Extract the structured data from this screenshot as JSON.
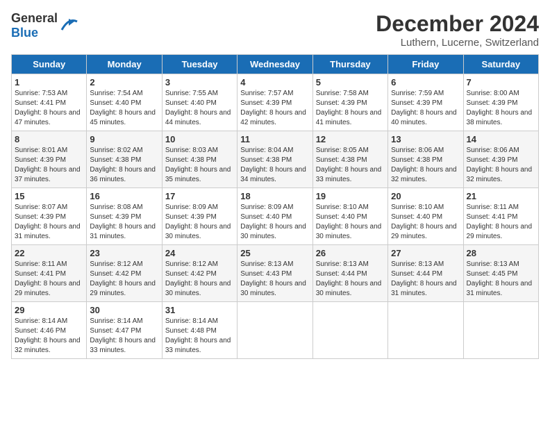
{
  "header": {
    "logo_general": "General",
    "logo_blue": "Blue",
    "month": "December 2024",
    "location": "Luthern, Lucerne, Switzerland"
  },
  "days_of_week": [
    "Sunday",
    "Monday",
    "Tuesday",
    "Wednesday",
    "Thursday",
    "Friday",
    "Saturday"
  ],
  "weeks": [
    [
      {
        "day": "1",
        "sunrise": "7:53 AM",
        "sunset": "4:41 PM",
        "daylight": "8 hours and 47 minutes."
      },
      {
        "day": "2",
        "sunrise": "7:54 AM",
        "sunset": "4:40 PM",
        "daylight": "8 hours and 45 minutes."
      },
      {
        "day": "3",
        "sunrise": "7:55 AM",
        "sunset": "4:40 PM",
        "daylight": "8 hours and 44 minutes."
      },
      {
        "day": "4",
        "sunrise": "7:57 AM",
        "sunset": "4:39 PM",
        "daylight": "8 hours and 42 minutes."
      },
      {
        "day": "5",
        "sunrise": "7:58 AM",
        "sunset": "4:39 PM",
        "daylight": "8 hours and 41 minutes."
      },
      {
        "day": "6",
        "sunrise": "7:59 AM",
        "sunset": "4:39 PM",
        "daylight": "8 hours and 40 minutes."
      },
      {
        "day": "7",
        "sunrise": "8:00 AM",
        "sunset": "4:39 PM",
        "daylight": "8 hours and 38 minutes."
      }
    ],
    [
      {
        "day": "8",
        "sunrise": "8:01 AM",
        "sunset": "4:39 PM",
        "daylight": "8 hours and 37 minutes."
      },
      {
        "day": "9",
        "sunrise": "8:02 AM",
        "sunset": "4:38 PM",
        "daylight": "8 hours and 36 minutes."
      },
      {
        "day": "10",
        "sunrise": "8:03 AM",
        "sunset": "4:38 PM",
        "daylight": "8 hours and 35 minutes."
      },
      {
        "day": "11",
        "sunrise": "8:04 AM",
        "sunset": "4:38 PM",
        "daylight": "8 hours and 34 minutes."
      },
      {
        "day": "12",
        "sunrise": "8:05 AM",
        "sunset": "4:38 PM",
        "daylight": "8 hours and 33 minutes."
      },
      {
        "day": "13",
        "sunrise": "8:06 AM",
        "sunset": "4:38 PM",
        "daylight": "8 hours and 32 minutes."
      },
      {
        "day": "14",
        "sunrise": "8:06 AM",
        "sunset": "4:39 PM",
        "daylight": "8 hours and 32 minutes."
      }
    ],
    [
      {
        "day": "15",
        "sunrise": "8:07 AM",
        "sunset": "4:39 PM",
        "daylight": "8 hours and 31 minutes."
      },
      {
        "day": "16",
        "sunrise": "8:08 AM",
        "sunset": "4:39 PM",
        "daylight": "8 hours and 31 minutes."
      },
      {
        "day": "17",
        "sunrise": "8:09 AM",
        "sunset": "4:39 PM",
        "daylight": "8 hours and 30 minutes."
      },
      {
        "day": "18",
        "sunrise": "8:09 AM",
        "sunset": "4:40 PM",
        "daylight": "8 hours and 30 minutes."
      },
      {
        "day": "19",
        "sunrise": "8:10 AM",
        "sunset": "4:40 PM",
        "daylight": "8 hours and 30 minutes."
      },
      {
        "day": "20",
        "sunrise": "8:10 AM",
        "sunset": "4:40 PM",
        "daylight": "8 hours and 29 minutes."
      },
      {
        "day": "21",
        "sunrise": "8:11 AM",
        "sunset": "4:41 PM",
        "daylight": "8 hours and 29 minutes."
      }
    ],
    [
      {
        "day": "22",
        "sunrise": "8:11 AM",
        "sunset": "4:41 PM",
        "daylight": "8 hours and 29 minutes."
      },
      {
        "day": "23",
        "sunrise": "8:12 AM",
        "sunset": "4:42 PM",
        "daylight": "8 hours and 29 minutes."
      },
      {
        "day": "24",
        "sunrise": "8:12 AM",
        "sunset": "4:42 PM",
        "daylight": "8 hours and 30 minutes."
      },
      {
        "day": "25",
        "sunrise": "8:13 AM",
        "sunset": "4:43 PM",
        "daylight": "8 hours and 30 minutes."
      },
      {
        "day": "26",
        "sunrise": "8:13 AM",
        "sunset": "4:44 PM",
        "daylight": "8 hours and 30 minutes."
      },
      {
        "day": "27",
        "sunrise": "8:13 AM",
        "sunset": "4:44 PM",
        "daylight": "8 hours and 31 minutes."
      },
      {
        "day": "28",
        "sunrise": "8:13 AM",
        "sunset": "4:45 PM",
        "daylight": "8 hours and 31 minutes."
      }
    ],
    [
      {
        "day": "29",
        "sunrise": "8:14 AM",
        "sunset": "4:46 PM",
        "daylight": "8 hours and 32 minutes."
      },
      {
        "day": "30",
        "sunrise": "8:14 AM",
        "sunset": "4:47 PM",
        "daylight": "8 hours and 33 minutes."
      },
      {
        "day": "31",
        "sunrise": "8:14 AM",
        "sunset": "4:48 PM",
        "daylight": "8 hours and 33 minutes."
      },
      null,
      null,
      null,
      null
    ]
  ],
  "labels": {
    "sunrise": "Sunrise: ",
    "sunset": "Sunset: ",
    "daylight": "Daylight: "
  }
}
